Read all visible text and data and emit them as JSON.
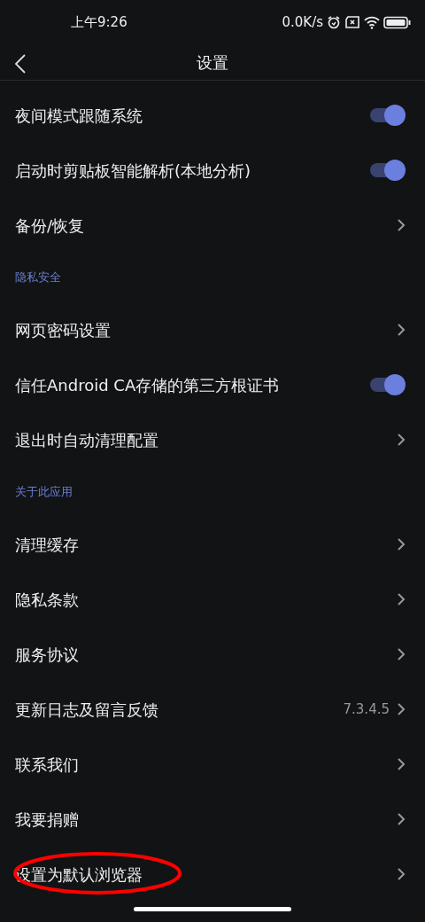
{
  "status_bar": {
    "time": "上午9:26",
    "net_speed": "0.0K/s"
  },
  "header": {
    "title": "设置"
  },
  "items": [
    {
      "kind": "toggle",
      "label": "夜间模式跟随系统",
      "on": true
    },
    {
      "kind": "toggle",
      "label": "启动时剪贴板智能解析(本地分析)",
      "on": true
    },
    {
      "kind": "link",
      "label": "备份/恢复"
    },
    {
      "kind": "section",
      "label": "隐私安全"
    },
    {
      "kind": "link",
      "label": "网页密码设置"
    },
    {
      "kind": "toggle",
      "label": "信任Android CA存储的第三方根证书",
      "on": true
    },
    {
      "kind": "link",
      "label": "退出时自动清理配置"
    },
    {
      "kind": "section",
      "label": "关于此应用"
    },
    {
      "kind": "link",
      "label": "清理缓存"
    },
    {
      "kind": "link",
      "label": "隐私条款"
    },
    {
      "kind": "link",
      "label": "服务协议"
    },
    {
      "kind": "link",
      "label": "更新日志及留言反馈",
      "value": "7.3.4.5"
    },
    {
      "kind": "link",
      "label": "联系我们"
    },
    {
      "kind": "link",
      "label": "我要捐赠"
    },
    {
      "kind": "link",
      "label": "设置为默认浏览器",
      "highlighted": true
    }
  ]
}
